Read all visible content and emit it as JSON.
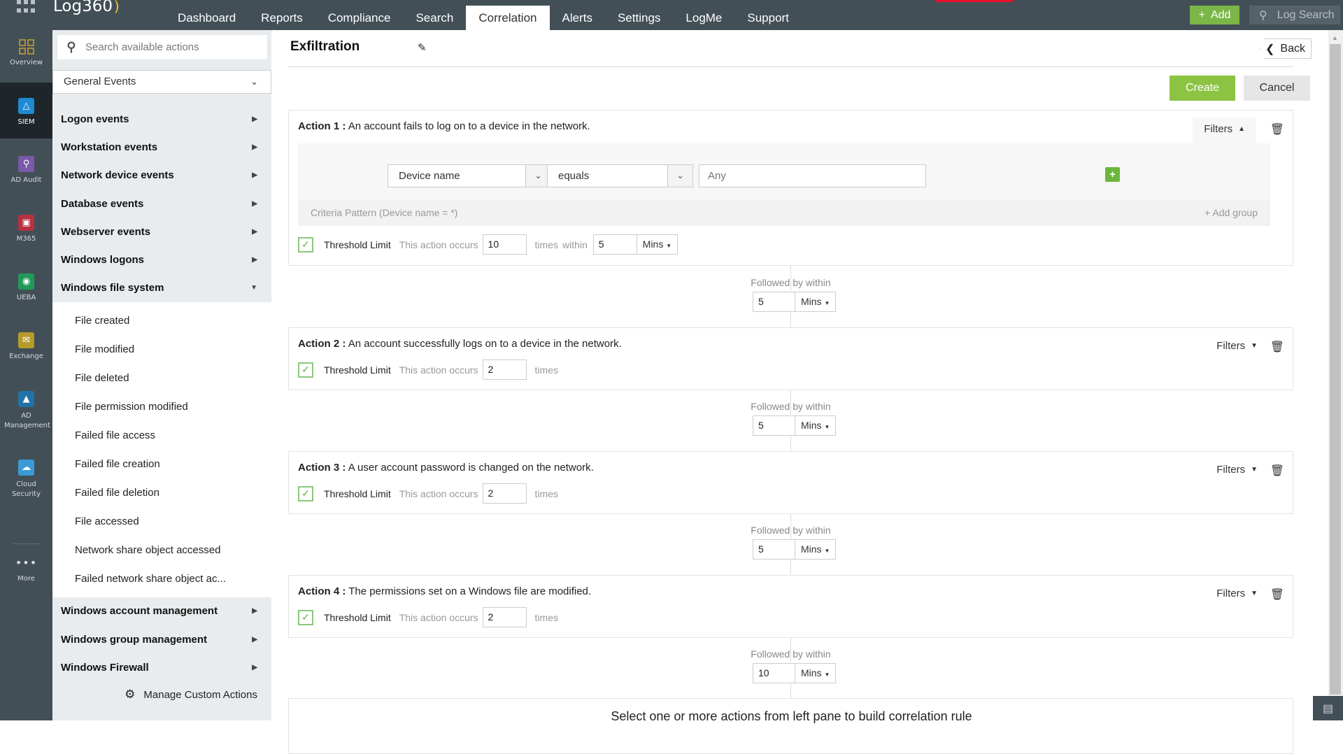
{
  "header": {
    "app_name": "Log360",
    "tabs": [
      {
        "label": "Dashboard",
        "active": false
      },
      {
        "label": "Reports",
        "active": false
      },
      {
        "label": "Compliance",
        "active": false
      },
      {
        "label": "Search",
        "active": false
      },
      {
        "label": "Correlation",
        "active": true
      },
      {
        "label": "Alerts",
        "active": false
      },
      {
        "label": "Settings",
        "active": false
      },
      {
        "label": "LogMe",
        "active": false
      },
      {
        "label": "Support",
        "active": false
      }
    ],
    "add_label": "Add",
    "log_search_label": "Log Search",
    "accent_green": "#7ab648"
  },
  "rail": {
    "items": [
      {
        "label": "Overview",
        "icon": "grid-icon",
        "color": "#c9a233",
        "active": false
      },
      {
        "label": "SIEM",
        "icon": "shield-icon",
        "color": "#1f8ad2",
        "active": true
      },
      {
        "label": "AD Audit",
        "icon": "magnifier-icon",
        "color": "#7a59a8",
        "active": false
      },
      {
        "label": "M365",
        "icon": "office-icon",
        "color": "#b7313f",
        "active": false
      },
      {
        "label": "UEBA",
        "icon": "eye-icon",
        "color": "#1f9b57",
        "active": false
      },
      {
        "label": "Exchange",
        "icon": "envelope-icon",
        "color": "#b79b2b",
        "active": false
      },
      {
        "label": "AD Management",
        "icon": "triangles-icon",
        "color": "#2272a8",
        "active": false
      },
      {
        "label": "Cloud Security",
        "icon": "cloud-lock-icon",
        "color": "#3a9bd7",
        "active": false
      },
      {
        "label": "More",
        "icon": "more-icon",
        "color": "",
        "active": false
      }
    ]
  },
  "panel": {
    "search_placeholder": "Search available actions",
    "category": "General Events",
    "groups_before": [
      "Logon events",
      "Workstation events",
      "Network device events",
      "Database events",
      "Webserver events",
      "Windows logons"
    ],
    "expanded_group": "Windows file system",
    "expanded_items": [
      "File created",
      "File modified",
      "File deleted",
      "File permission modified",
      "Failed file access",
      "Failed file creation",
      "Failed file deletion",
      "File accessed",
      "Network share object accessed",
      "Failed network share object ac..."
    ],
    "groups_after": [
      "Windows account management",
      "Windows group management",
      "Windows Firewall"
    ],
    "manage_label": "Manage Custom Actions"
  },
  "main": {
    "title": "Exfiltration",
    "back_label": "Back",
    "create_label": "Create",
    "cancel_label": "Cancel",
    "filters_label": "Filters",
    "actions": [
      {
        "prefix": "Action 1 :",
        "description": "An account fails to log on to a device in the network.",
        "filters_open": true,
        "criteria_field": "Device name",
        "criteria_operator": "equals",
        "criteria_value_placeholder": "Any",
        "criteria_pattern": "Criteria Pattern (Device name = *)",
        "add_group_label": "+ Add group",
        "threshold_checked": true,
        "threshold_label": "Threshold Limit",
        "occurs_label": "This action occurs",
        "occurs_count": "10",
        "times_label": "times",
        "within_label": "within",
        "within_value": "5",
        "within_unit": "Mins"
      },
      {
        "prefix": "Action 2 :",
        "description": "An account successfully logs on to a device in the network.",
        "filters_open": false,
        "threshold_checked": true,
        "threshold_label": "Threshold Limit",
        "occurs_label": "This action occurs",
        "occurs_count": "2",
        "times_label": "times"
      },
      {
        "prefix": "Action 3 :",
        "description": "A user account password is changed on the network.",
        "filters_open": false,
        "threshold_checked": true,
        "threshold_label": "Threshold Limit",
        "occurs_label": "This action occurs",
        "occurs_count": "2",
        "times_label": "times"
      },
      {
        "prefix": "Action 4 :",
        "description": "The permissions set on a Windows file are modified.",
        "filters_open": false,
        "threshold_checked": true,
        "threshold_label": "Threshold Limit",
        "occurs_label": "This action occurs",
        "occurs_count": "2",
        "times_label": "times"
      }
    ],
    "followed_by": [
      {
        "label": "Followed by within",
        "value": "5",
        "unit": "Mins"
      },
      {
        "label": "Followed by within",
        "value": "5",
        "unit": "Mins"
      },
      {
        "label": "Followed by within",
        "value": "5",
        "unit": "Mins"
      },
      {
        "label": "Followed by within",
        "value": "10",
        "unit": "Mins"
      }
    ],
    "empty_hint": "Select one or more actions from left pane to build correlation rule"
  }
}
